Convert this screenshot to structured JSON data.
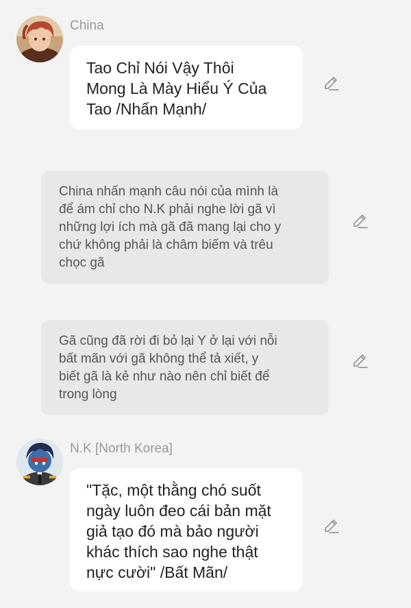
{
  "colors": {
    "background": "#f3f3f3",
    "bubble": "#ffffff",
    "narration_bubble": "#e8e8e8",
    "speaker_name": "#9a9a9a",
    "dialogue_text": "#222222",
    "narration_text": "#555555",
    "edit_icon": "#999999"
  },
  "messages": [
    {
      "type": "dialogue",
      "speaker": "China",
      "avatar_icon": "avatar-china",
      "text": "Tao Chỉ Nói Vậy Thôi\nMong Là Mày Hiểu Ý Của\nTao /Nhấn Mạnh/",
      "edit_icon": "pencil-icon"
    },
    {
      "type": "narration",
      "text": "China nhấn mạnh câu nói của mình là\nđể ám chỉ cho N.K phải nghe lời gã vì\nnhững lợi ích mà gã đã mang lại cho y\nchứ không phải là châm biếm và trêu\nchọc gã",
      "edit_icon": "pencil-icon"
    },
    {
      "type": "narration",
      "text": "Gã cũng đã rời đi bỏ lại Y ở lại với nỗi\nbất mãn với gã không thể tả xiết, y\nbiết gã là kẻ như nào nên chỉ biết để\ntrong lòng",
      "edit_icon": "pencil-icon"
    },
    {
      "type": "dialogue",
      "speaker": "N.K [North Korea]",
      "avatar_icon": "avatar-north-korea",
      "text": "\"Tặc, một thằng chó suốt\nngày luôn đeo cái bản mặt\ngiả tạo đó mà bảo người\nkhác thích sao nghe thật\nnực cười\" /Bất Mãn/",
      "edit_icon": "pencil-icon"
    }
  ]
}
